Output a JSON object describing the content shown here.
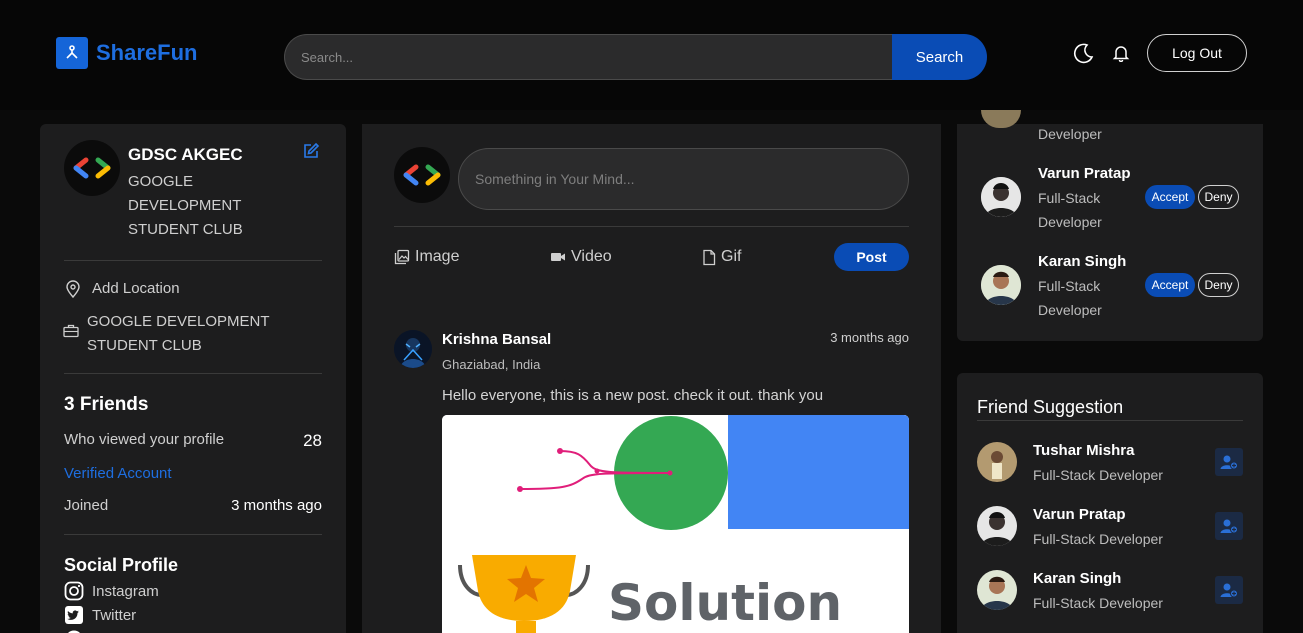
{
  "header": {
    "logo_text": "ShareFun",
    "search_placeholder": "Search...",
    "search_button": "Search",
    "logout_button": "Log Out"
  },
  "profile": {
    "name": "GDSC AKGEC",
    "org_line1": "GOOGLE",
    "org_line2": "DEVELOPMENT",
    "org_line3": "STUDENT CLUB",
    "location": "Add Location",
    "work_line1": "GOOGLE DEVELOPMENT",
    "work_line2": "STUDENT CLUB",
    "friends": "3 Friends",
    "viewed_label": "Who viewed your profile",
    "viewed_count": "28",
    "verified": "Verified Account",
    "joined_label": "Joined",
    "joined_value": "3 months ago",
    "social_title": "Social Profile",
    "social": [
      "Instagram",
      "Twitter"
    ]
  },
  "composer": {
    "placeholder": "Something in Your Mind...",
    "image": "Image",
    "video": "Video",
    "gif": "Gif",
    "post": "Post"
  },
  "post": {
    "author": "Krishna Bansal",
    "location": "Ghaziabad, India",
    "time": "3 months ago",
    "text": "Hello everyone, this is a new post. check it out. thank you",
    "image_word": "Solution"
  },
  "requests": {
    "partial_role": "Developer",
    "items": [
      {
        "name": "Varun Pratap",
        "role1": "Full-Stack",
        "role2": "Developer",
        "accept": "Accept",
        "deny": "Deny"
      },
      {
        "name": "Karan Singh",
        "role1": "Full-Stack",
        "role2": "Developer",
        "accept": "Accept",
        "deny": "Deny"
      }
    ]
  },
  "suggestions": {
    "title": "Friend Suggestion",
    "items": [
      {
        "name": "Tushar Mishra",
        "role": "Full-Stack Developer"
      },
      {
        "name": "Varun Pratap",
        "role": "Full-Stack Developer"
      },
      {
        "name": "Karan Singh",
        "role": "Full-Stack Developer"
      }
    ]
  }
}
